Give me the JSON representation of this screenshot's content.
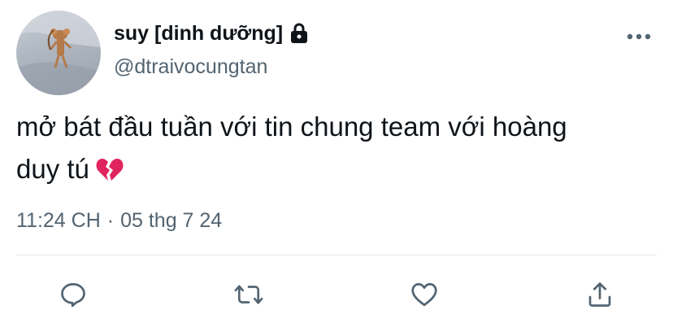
{
  "tweet": {
    "display_name": "suy [dinh dưỡng]",
    "handle": "@dtraivocungtan",
    "text_line1": "mở bát đầu tuần với tin chung team với hoàng",
    "text_line2": "duy tú",
    "emoji": "💔",
    "time": "11:24 CH",
    "date": "05 thg 7 24",
    "separator": "·"
  },
  "icons": {
    "lock": "lock-icon",
    "more": "more-horizontal-icon",
    "reply": "reply-icon",
    "retweet": "retweet-icon",
    "like": "heart-outline-icon",
    "share": "share-icon",
    "broken_heart": "broken-heart-icon"
  },
  "colors": {
    "text": "#0f1419",
    "secondary": "#536471",
    "divider": "#e6ecf0",
    "broken_heart": "#e0245e"
  }
}
